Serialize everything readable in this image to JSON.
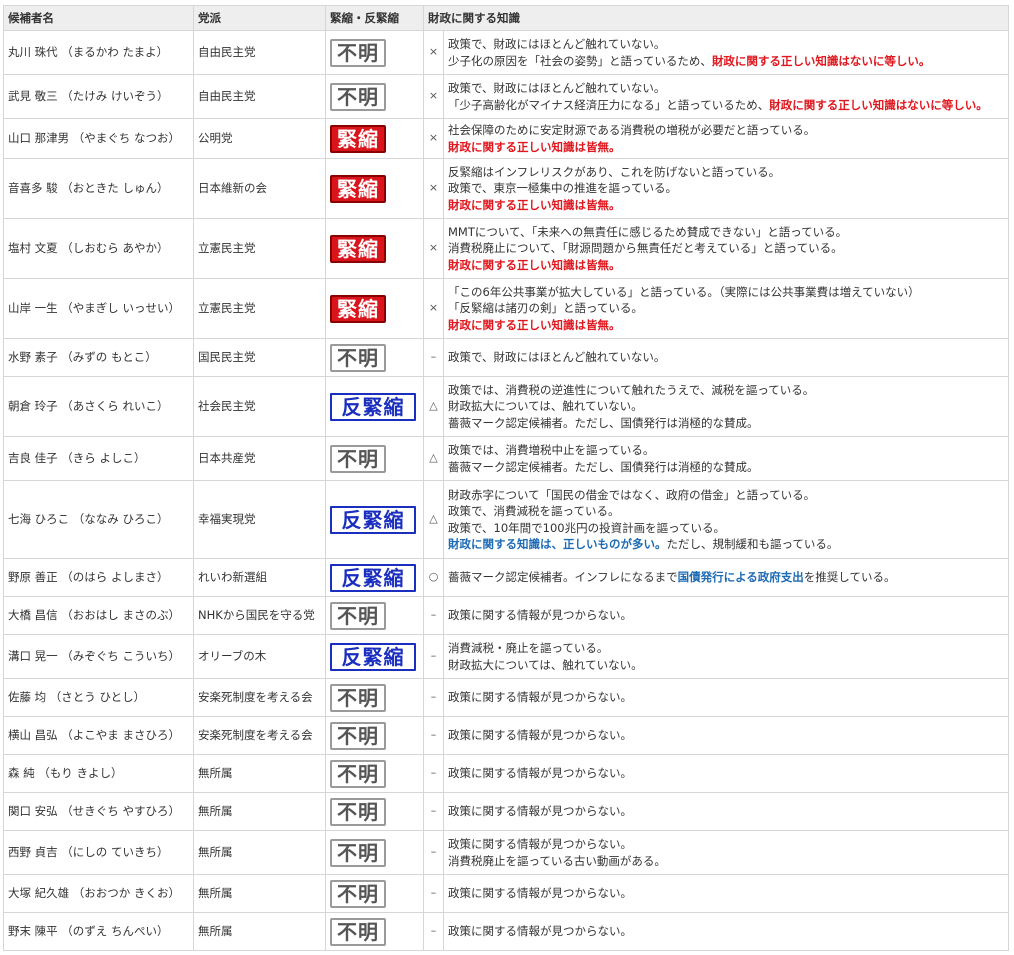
{
  "headers": {
    "name": "候補者名",
    "party": "党派",
    "stance": "緊縮・反緊縮",
    "knowledge": "財政に関する知識"
  },
  "badge_colors": {
    "tight": "#d9141b",
    "anti": "#1a2fbf",
    "unknown": "#555555"
  },
  "rows": [
    {
      "name": "丸川 珠代 （まるかわ たまよ）",
      "party": "自由民主党",
      "badge": "不明",
      "badge_type": "unknown",
      "mark": "×",
      "lines": [
        [
          {
            "t": "政策で、財政にはほとんど触れていない。"
          }
        ],
        [
          {
            "t": "少子化の原因を「社会の姿勢」と語っているため、"
          },
          {
            "t": "財政に関する正しい知識はないに等しい。",
            "s": "red"
          }
        ]
      ]
    },
    {
      "name": "武見 敬三 （たけみ けいぞう）",
      "party": "自由民主党",
      "badge": "不明",
      "badge_type": "unknown",
      "mark": "×",
      "lines": [
        [
          {
            "t": "政策で、財政にはほとんど触れていない。"
          }
        ],
        [
          {
            "t": "「少子高齢化がマイナス経済圧力になる」と語っているため、"
          },
          {
            "t": "財政に関する正しい知識はないに等しい。",
            "s": "red"
          }
        ]
      ]
    },
    {
      "name": "山口 那津男 （やまぐち なつお）",
      "party": "公明党",
      "badge": "緊縮",
      "badge_type": "tight",
      "mark": "×",
      "lines": [
        [
          {
            "t": "社会保障のために安定財源である消費税の増税が必要だと語っている。"
          }
        ],
        [
          {
            "t": "財政に関する正しい知識は皆無。",
            "s": "red"
          }
        ]
      ]
    },
    {
      "name": "音喜多 駿 （おときた しゅん）",
      "party": "日本維新の会",
      "badge": "緊縮",
      "badge_type": "tight",
      "mark": "×",
      "lines": [
        [
          {
            "t": "反緊縮はインフレリスクがあり、これを防げないと語っている。"
          }
        ],
        [
          {
            "t": "政策で、東京一極集中の推進を謳っている。"
          }
        ],
        [
          {
            "t": "財政に関する正しい知識は皆無。",
            "s": "red"
          }
        ]
      ]
    },
    {
      "name": "塩村 文夏 （しおむら あやか）",
      "party": "立憲民主党",
      "badge": "緊縮",
      "badge_type": "tight",
      "mark": "×",
      "lines": [
        [
          {
            "t": "MMTについて、「未来への無責任に感じるため賛成できない」と語っている。"
          }
        ],
        [
          {
            "t": "消費税廃止について、「財源問題から無責任だと考えている」と語っている。"
          }
        ],
        [
          {
            "t": "財政に関する正しい知識は皆無。",
            "s": "red"
          }
        ]
      ]
    },
    {
      "name": "山岸 一生 （やまぎし いっせい）",
      "party": "立憲民主党",
      "badge": "緊縮",
      "badge_type": "tight",
      "mark": "×",
      "lines": [
        [
          {
            "t": "「この6年公共事業が拡大している」と語っている。（実際には公共事業費は増えていない）"
          }
        ],
        [
          {
            "t": "「反緊縮は諸刃の剣」と語っている。"
          }
        ],
        [
          {
            "t": "財政に関する正しい知識は皆無。",
            "s": "red"
          }
        ]
      ]
    },
    {
      "name": "水野 素子 （みずの もとこ）",
      "party": "国民民主党",
      "badge": "不明",
      "badge_type": "unknown",
      "mark": "–",
      "lines": [
        [
          {
            "t": "政策で、財政にはほとんど触れていない。"
          }
        ]
      ]
    },
    {
      "name": "朝倉 玲子 （あさくら れいこ）",
      "party": "社会民主党",
      "badge": "反緊縮",
      "badge_type": "anti",
      "mark": "△",
      "lines": [
        [
          {
            "t": "政策では、消費税の逆進性について触れたうえで、減税を謳っている。"
          }
        ],
        [
          {
            "t": "財政拡大については、触れていない。"
          }
        ],
        [
          {
            "t": "薔薇マーク認定候補者。ただし、国債発行は消極的な賛成。"
          }
        ]
      ]
    },
    {
      "name": "吉良 佳子 （きら よしこ）",
      "party": "日本共産党",
      "badge": "不明",
      "badge_type": "unknown",
      "mark": "△",
      "lines": [
        [
          {
            "t": "政策では、消費増税中止を謳っている。"
          }
        ],
        [
          {
            "t": "薔薇マーク認定候補者。ただし、国債発行は消極的な賛成。"
          }
        ]
      ]
    },
    {
      "name": "七海 ひろこ （ななみ ひろこ）",
      "party": "幸福実現党",
      "badge": "反緊縮",
      "badge_type": "anti",
      "mark": "△",
      "lines": [
        [
          {
            "t": "財政赤字について「国民の借金ではなく、政府の借金」と語っている。"
          }
        ],
        [
          {
            "t": "政策で、消費減税を謳っている。"
          }
        ],
        [
          {
            "t": "政策で、10年間で100兆円の投資計画を謳っている。"
          }
        ],
        [
          {
            "t": "財政に関する知識は、正しいものが多い。",
            "s": "blue"
          },
          {
            "t": "ただし、規制緩和も謳っている。"
          }
        ]
      ]
    },
    {
      "name": "野原 善正 （のはら よしまさ）",
      "party": "れいわ新選組",
      "badge": "反緊縮",
      "badge_type": "anti",
      "mark": "○",
      "lines": [
        [
          {
            "t": "薔薇マーク認定候補者。インフレになるまで"
          },
          {
            "t": "国債発行による政府支出",
            "s": "blue"
          },
          {
            "t": "を推奨している。"
          }
        ]
      ]
    },
    {
      "name": "大橋 昌信 （おおはし まさのぶ）",
      "party": "NHKから国民を守る党",
      "badge": "不明",
      "badge_type": "unknown",
      "mark": "–",
      "lines": [
        [
          {
            "t": "政策に関する情報が見つからない。"
          }
        ]
      ]
    },
    {
      "name": "溝口 晃一 （みぞぐち こういち）",
      "party": "オリーブの木",
      "badge": "反緊縮",
      "badge_type": "anti",
      "mark": "–",
      "lines": [
        [
          {
            "t": "消費減税・廃止を謳っている。"
          }
        ],
        [
          {
            "t": "財政拡大については、触れていない。"
          }
        ]
      ]
    },
    {
      "name": "佐藤 均 （さとう ひとし）",
      "party": "安楽死制度を考える会",
      "badge": "不明",
      "badge_type": "unknown",
      "mark": "–",
      "lines": [
        [
          {
            "t": "政策に関する情報が見つからない。"
          }
        ]
      ]
    },
    {
      "name": "横山 昌弘 （よこやま まさひろ）",
      "party": "安楽死制度を考える会",
      "badge": "不明",
      "badge_type": "unknown",
      "mark": "–",
      "lines": [
        [
          {
            "t": "政策に関する情報が見つからない。"
          }
        ]
      ]
    },
    {
      "name": "森 純 （もり きよし）",
      "party": "無所属",
      "badge": "不明",
      "badge_type": "unknown",
      "mark": "–",
      "lines": [
        [
          {
            "t": "政策に関する情報が見つからない。"
          }
        ]
      ]
    },
    {
      "name": "関口 安弘 （せきぐち やすひろ）",
      "party": "無所属",
      "badge": "不明",
      "badge_type": "unknown",
      "mark": "–",
      "lines": [
        [
          {
            "t": "政策に関する情報が見つからない。"
          }
        ]
      ]
    },
    {
      "name": "西野 貞吉 （にしの ていきち）",
      "party": "無所属",
      "badge": "不明",
      "badge_type": "unknown",
      "mark": "–",
      "lines": [
        [
          {
            "t": "政策に関する情報が見つからない。"
          }
        ],
        [
          {
            "t": "消費税廃止を謳っている古い動画がある。"
          }
        ]
      ]
    },
    {
      "name": "大塚 紀久雄 （おおつか きくお）",
      "party": "無所属",
      "badge": "不明",
      "badge_type": "unknown",
      "mark": "–",
      "lines": [
        [
          {
            "t": "政策に関する情報が見つからない。"
          }
        ]
      ]
    },
    {
      "name": "野末 陳平 （のずえ ちんぺい）",
      "party": "無所属",
      "badge": "不明",
      "badge_type": "unknown",
      "mark": "–",
      "lines": [
        [
          {
            "t": "政策に関する情報が見つからない。"
          }
        ]
      ]
    }
  ]
}
